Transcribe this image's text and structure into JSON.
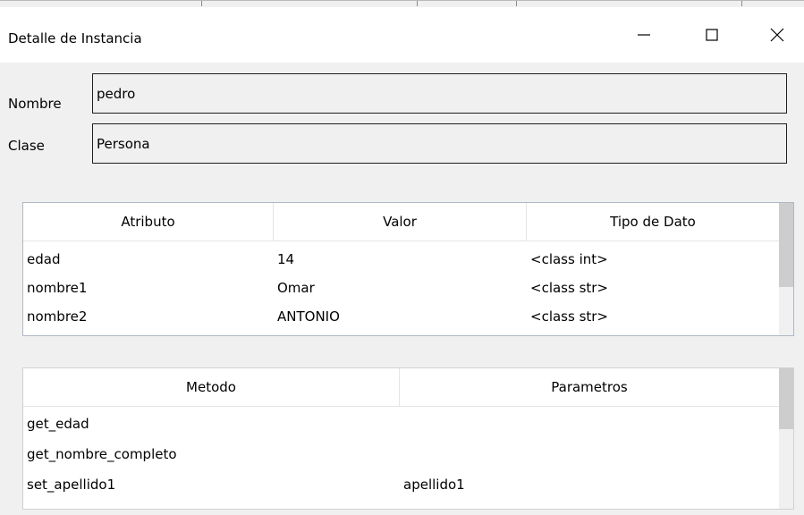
{
  "window": {
    "title": "Detalle de Instancia",
    "minimize_symbol": "—",
    "close_symbol": "✕"
  },
  "form": {
    "nombre_label": "Nombre",
    "nombre_value": "pedro",
    "clase_label": "Clase",
    "clase_value": "Persona"
  },
  "attributes_table": {
    "headers": [
      "Atributo",
      "Valor",
      "Tipo de Dato"
    ],
    "rows": [
      [
        "edad",
        "14",
        "<class int>"
      ],
      [
        "nombre1",
        "Omar",
        "<class str>"
      ],
      [
        "nombre2",
        "ANTONIO",
        "<class str>"
      ]
    ]
  },
  "methods_table": {
    "headers": [
      "Metodo",
      "Parametros"
    ],
    "rows": [
      [
        "get_edad",
        ""
      ],
      [
        "get_nombre_completo",
        ""
      ],
      [
        "set_apellido1",
        "apellido1"
      ]
    ]
  }
}
